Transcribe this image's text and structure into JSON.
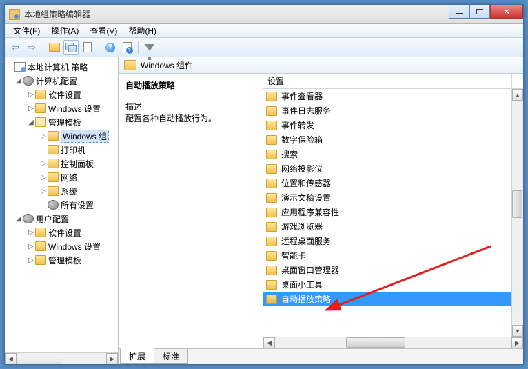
{
  "window": {
    "title": "本地组策略编辑器"
  },
  "titlebuttons": {
    "min": "_",
    "max": "□",
    "close": "×"
  },
  "menu": {
    "file": "文件(F)",
    "action": "操作(A)",
    "view": "查看(V)",
    "help": "帮助(H)"
  },
  "tree": {
    "root": "本地计算机 策略",
    "computer": "计算机配置",
    "soft1": "软件设置",
    "win1": "Windows 设置",
    "admin1": "管理模板",
    "wincomp": "Windows 组",
    "printer": "打印机",
    "ctrlpanel": "控制面板",
    "network": "网络",
    "system": "系统",
    "allsettings": "所有设置",
    "user": "用户配置",
    "soft2": "软件设置",
    "win2": "Windows 设置",
    "admin2": "管理模板"
  },
  "path": {
    "label": "Windows 组件"
  },
  "desc": {
    "title": "自动播放策略",
    "label": "描述:",
    "text": "配置各种自动播放行为。"
  },
  "listheader": {
    "setting": "设置"
  },
  "items": [
    "事件查看器",
    "事件日志服务",
    "事件转发",
    "数字保险箱",
    "搜索",
    "网络投影仪",
    "位置和传感器",
    "演示文稿设置",
    "应用程序兼容性",
    "游戏浏览器",
    "远程桌面服务",
    "智能卡",
    "桌面窗口管理器",
    "桌面小工具",
    "自动播放策略"
  ],
  "tabs": {
    "ext": "扩展",
    "std": "标准"
  }
}
